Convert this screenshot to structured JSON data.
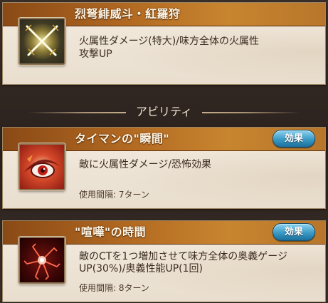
{
  "support_skill": {
    "title": "烈弩緋威斗・紅羅狩",
    "description_line1": "火属性ダメージ(特大)/味方全体の火属性",
    "description_line2": "攻撃UP",
    "icon": "crossed-swords-icon"
  },
  "section": {
    "label": "アビリティ"
  },
  "abilities": [
    {
      "name": "タイマンの\"瞬間\"",
      "effect_button": "効果",
      "description_line1": "敵に火属性ダメージ/恐怖効果",
      "description_line2": "",
      "cooldown": "使用間隔: 7ターン",
      "icon": "fire-eye-icon"
    },
    {
      "name": "\"喧嘩\"の時間",
      "effect_button": "効果",
      "description_line1": "敵のCTを1つ増加させて味方全体の奥義ゲージ",
      "description_line2": "UP(30%)/奥義性能UP(1回)",
      "cooldown": "使用間隔: 8ターン",
      "icon": "red-lightning-icon"
    }
  ]
}
